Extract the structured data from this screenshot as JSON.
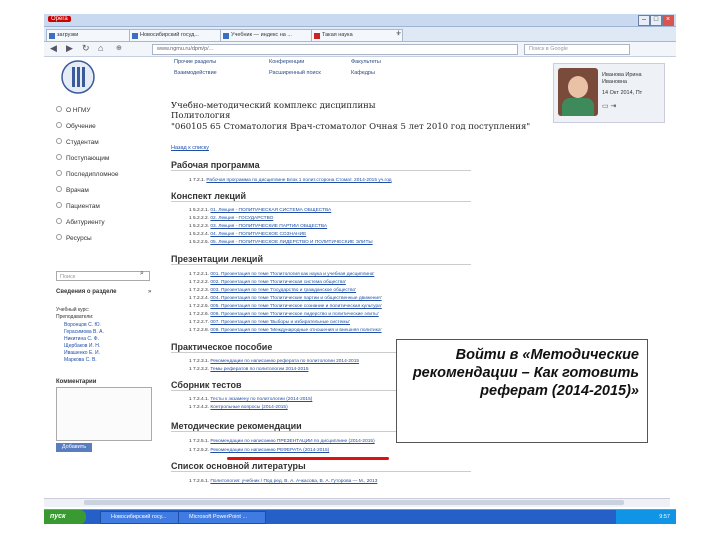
{
  "browser": {
    "app_name": "Opera",
    "tabs": [
      {
        "label": "загрузки"
      },
      {
        "label": "Новосибирский госуд..."
      },
      {
        "label": "Учебник — индекс на ..."
      },
      {
        "label": "Такая наука"
      }
    ],
    "url": "www.ngmu.ru/dpm/p/...",
    "search_placeholder": "Поиск в Google"
  },
  "top_nav": [
    "Прочие разделы",
    "Конференции",
    "Факультеты",
    "Взаимодействие",
    "Расширенный поиск",
    "Кафедры"
  ],
  "user": {
    "name": "Иванова Ирина Ивановна",
    "date": "14 Окт 2014, Пт"
  },
  "sidebar": {
    "items": [
      "О НГМУ",
      "Обучение",
      "Студентам",
      "Поступающим",
      "Последипломное",
      "Врачам",
      "Пациентам",
      "Абитуриенту",
      "Ресурсы"
    ],
    "search_placeholder": "Поиск",
    "section_label": "Сведения о разделе",
    "course_label": "Учебный курс:",
    "teachers_label": "Преподаватели:",
    "teachers": [
      "Воронцов С. Ю.",
      "Герасимова В. А.",
      "Никитина С. Ф.",
      "Щербаков И. Н.",
      "Ивашенко Е. И.",
      "Маркова С. В."
    ],
    "comments_label": "Комментарии",
    "comments_button": "Добавить"
  },
  "main": {
    "heading_line1": "Учебно-методический комплекс дисциплины",
    "heading_line2": "Политология",
    "heading_line3": "\"060105 65 Стоматология Врач-стоматолог Очная 5 лет 2010 год поступления\"",
    "back_link": "Назад к списку",
    "sections": [
      {
        "title": "Рабочая программа",
        "items": [
          {
            "num": "1 7.2.1.",
            "text": "Рабочая программа по дисциплине Блок 1 полит.сторона Стомат. 2014-2015 уч.год"
          }
        ]
      },
      {
        "title": "Конспект лекций",
        "items": [
          {
            "num": "1 5.2.2.1.",
            "text": "01. Лекция - ПОЛИТИЧЕСКАЯ СИСТЕМА ОБЩЕСТВА"
          },
          {
            "num": "1 5.2.2.2.",
            "text": "02. Лекция - ГОСУДАРСТВО"
          },
          {
            "num": "1 5.2.2.3.",
            "text": "03. Лекция - ПОЛИТИЧЕСКИЕ ПАРТИИ ОБЩЕСТВА"
          },
          {
            "num": "1 5.2.2.4.",
            "text": "04. Лекция - ПОЛИТИЧЕСКОЕ СОЗНАНИЕ"
          },
          {
            "num": "1 5.2.2.5.",
            "text": "05. Лекция - ПОЛИТИЧЕСКОЕ ЛИДЕРСТВО И ПОЛИТИЧЕСКИЕ ЭЛИТЫ"
          }
        ]
      },
      {
        "title": "Презентации лекций",
        "items": [
          {
            "num": "1 7.2.2.1.",
            "text": "001. Презентация по теме 'Политология как наука и учебная дисциплина'"
          },
          {
            "num": "1 7.2.2.2.",
            "text": "002. Презентация по теме 'Политическая система общества'"
          },
          {
            "num": "1 7.2.2.3.",
            "text": "003. Презентация по теме 'Государство и гражданское общество'"
          },
          {
            "num": "1 7.2.2.4.",
            "text": "004. Презентация по теме 'Политические партии и общественные движения'"
          },
          {
            "num": "1 7.2.2.5.",
            "text": "005. Презентация по теме 'Политическое сознание и политическая культура'"
          },
          {
            "num": "1 7.2.2.6.",
            "text": "006. Презентация по теме 'Политическое лидерство и политические элиты'"
          },
          {
            "num": "1 7.2.2.7.",
            "text": "007. Презентация по теме 'Выборы и избирательные системы'"
          },
          {
            "num": "1 7.2.2.8.",
            "text": "008. Презентация по теме 'Международные отношения и внешняя политика'"
          }
        ]
      },
      {
        "title": "Практическое пособие",
        "items": [
          {
            "num": "1 7.2.3.1.",
            "text": "Рекомендации по написанию реферата по политологии 2014-2015"
          },
          {
            "num": "1 7.2.3.2.",
            "text": "Темы рефератов по политологии 2014-2015"
          }
        ]
      },
      {
        "title": "Сборник тестов",
        "items": [
          {
            "num": "1 7.2.4.1.",
            "text": "Тесты к экзамену по политологии (2014-2015)"
          },
          {
            "num": "1 7.2.4.2.",
            "text": "Контрольные вопросы (2014-2015)"
          }
        ]
      },
      {
        "title": "Методические рекомендации",
        "items": [
          {
            "num": "1 7.2.5.1.",
            "text": "Рекомендации по написанию ПРЕЗЕНТАЦИИ по дисциплине (2014-2015)"
          },
          {
            "num": "1 7.2.5.2.",
            "text": "Рекомендации по написанию РЕФЕРАТА (2014-2015)"
          }
        ]
      },
      {
        "title": "Список основной литературы",
        "items": [
          {
            "num": "1 7.2.6.1.",
            "text": "Политология: учебник / Под ред. В. А. Ачкасова, В. А. Гуторова — М., 2013"
          }
        ]
      }
    ]
  },
  "callout": "Войти в «Методические рекомендации – Как готовить реферат (2014-2015)»",
  "taskbar": {
    "start": "пуск",
    "items": [
      "Новосибирский госу...",
      "Microsoft PowerPoint ..."
    ],
    "clock": "9:57"
  },
  "colors": {
    "link": "#1f4fa8",
    "accent_red": "#d11",
    "taskbar": "#2560c9"
  }
}
